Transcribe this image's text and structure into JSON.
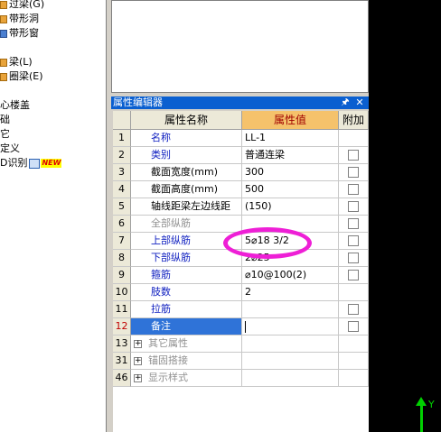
{
  "tree": {
    "items": [
      {
        "label": "过梁(G)",
        "icon": "orange"
      },
      {
        "label": "带形洞",
        "icon": "orange"
      },
      {
        "label": "带形窗",
        "icon": "blue"
      },
      {
        "label": "梁(L)",
        "icon": "orange"
      },
      {
        "label": "圈梁(E)",
        "icon": "orange"
      },
      {
        "label": "心楼盖",
        "icon": ""
      },
      {
        "label": "础",
        "icon": ""
      },
      {
        "label": "它",
        "icon": ""
      },
      {
        "label": "定义",
        "icon": ""
      },
      {
        "label": "D识别",
        "icon": ""
      }
    ],
    "new_badge": "NEW"
  },
  "prop_editor": {
    "title": "属性编辑器",
    "pin_icon": "pin-icon",
    "close_icon": "close-icon",
    "headers": {
      "name": "属性名称",
      "value": "属性值",
      "add": "附加"
    },
    "rows": [
      {
        "num": "1",
        "name": "名称",
        "value": "LL-1",
        "checkbox": false
      },
      {
        "num": "2",
        "name": "类别",
        "value": "普通连梁",
        "checkbox": true
      },
      {
        "num": "3",
        "name": "截面宽度(mm)",
        "value": "300",
        "checkbox": true
      },
      {
        "num": "4",
        "name": "截面高度(mm)",
        "value": "500",
        "checkbox": true
      },
      {
        "num": "5",
        "name": "轴线距梁左边线距",
        "value": "(150)",
        "checkbox": true
      },
      {
        "num": "6",
        "name": "全部纵筋",
        "value": "",
        "checkbox": true
      },
      {
        "num": "7",
        "name": "上部纵筋",
        "value": "5⌀18 3/2",
        "checkbox": true
      },
      {
        "num": "8",
        "name": "下部纵筋",
        "value": "2⌀25",
        "checkbox": true
      },
      {
        "num": "9",
        "name": "箍筋",
        "value": "⌀10@100(2)",
        "checkbox": true
      },
      {
        "num": "10",
        "name": "肢数",
        "value": "2",
        "checkbox": false
      },
      {
        "num": "11",
        "name": "拉筋",
        "value": "",
        "checkbox": true
      },
      {
        "num": "12",
        "name": "备注",
        "value": "",
        "checkbox": true
      },
      {
        "num": "13",
        "name": "其它属性",
        "value": "",
        "checkbox": false
      },
      {
        "num": "31",
        "name": "锚固搭接",
        "value": "",
        "checkbox": false
      },
      {
        "num": "46",
        "name": "显示样式",
        "value": "",
        "checkbox": false
      }
    ]
  },
  "axis": {
    "label": "Y"
  },
  "colors": {
    "title_bar": "#0a5fd0",
    "highlight_header": "#f5c26b",
    "annotation_ellipse": "#ee1fd6",
    "axis": "#00d000",
    "selection": "#2f73d8"
  }
}
